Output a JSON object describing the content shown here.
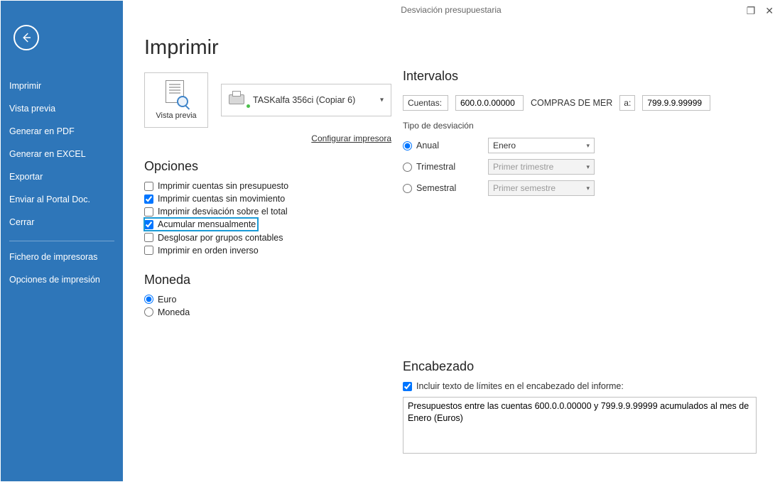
{
  "window": {
    "title": "Desviación presupuestaria"
  },
  "sidebar": {
    "items": [
      "Imprimir",
      "Vista previa",
      "Generar en PDF",
      "Generar en EXCEL",
      "Exportar",
      "Enviar al Portal Doc.",
      "Cerrar"
    ],
    "extras": [
      "Fichero de impresoras",
      "Opciones de impresión"
    ]
  },
  "header": {
    "title": "Imprimir"
  },
  "preview": {
    "label": "Vista previa"
  },
  "printer": {
    "name": "TASKalfa 356ci (Copiar 6)"
  },
  "links": {
    "configure": "Configurar impresora"
  },
  "opciones": {
    "title": "Opciones",
    "items": [
      {
        "label": "Imprimir cuentas sin presupuesto",
        "checked": false
      },
      {
        "label": "Imprimir cuentas sin movimiento",
        "checked": true
      },
      {
        "label": "Imprimir desviación sobre el total",
        "checked": false
      },
      {
        "label": "Acumular mensualmente",
        "checked": true,
        "highlight": true
      },
      {
        "label": "Desglosar por grupos contables",
        "checked": false
      },
      {
        "label": "Imprimir en orden inverso",
        "checked": false
      }
    ]
  },
  "moneda": {
    "title": "Moneda",
    "options": [
      {
        "label": "Euro",
        "selected": true
      },
      {
        "label": "Moneda",
        "selected": false
      }
    ]
  },
  "intervalos": {
    "title": "Intervalos",
    "cuentas_label": "Cuentas:",
    "from": "600.0.0.00000",
    "desc": "COMPRAS DE MER",
    "a_label": "a:",
    "to": "799.9.9.99999",
    "tipo_label": "Tipo de desviación",
    "tipo": [
      {
        "label": "Anual",
        "value": "Enero",
        "selected": true,
        "enabled": true
      },
      {
        "label": "Trimestral",
        "value": "Primer trimestre",
        "selected": false,
        "enabled": false
      },
      {
        "label": "Semestral",
        "value": "Primer semestre",
        "selected": false,
        "enabled": false
      }
    ]
  },
  "encabezado": {
    "title": "Encabezado",
    "chk_label": "Incluir texto de límites en el encabezado del informe:",
    "text": "Presupuestos entre las cuentas 600.0.0.00000 y 799.9.9.99999 acumulados al mes de Enero (Euros)"
  }
}
